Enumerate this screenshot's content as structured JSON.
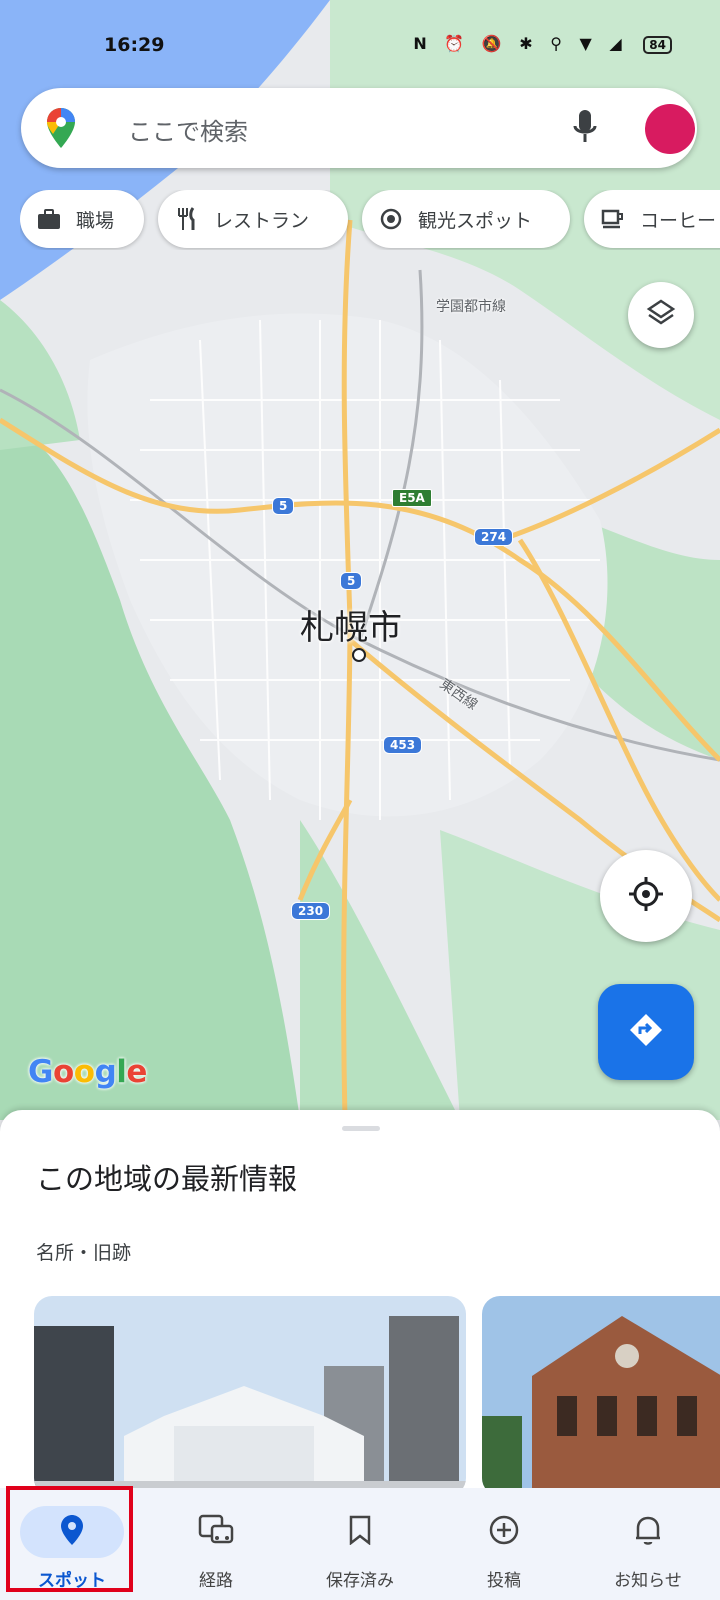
{
  "status_bar": {
    "time": "16:29",
    "icons": "N ⏰ 🔕 ✱ ⚲ ▼ ◢",
    "battery": "84"
  },
  "search": {
    "placeholder": "ここで検索"
  },
  "chips": [
    {
      "label": "職場",
      "icon": "briefcase-icon"
    },
    {
      "label": "レストラン",
      "icon": "fork-knife-icon"
    },
    {
      "label": "観光スポット",
      "icon": "camera-icon"
    },
    {
      "label": "コーヒー",
      "icon": "coffee-icon"
    }
  ],
  "map": {
    "city_label": "札幌市",
    "labels": [
      "学園都市線",
      "東西線"
    ],
    "shields": [
      "5",
      "5",
      "E5A",
      "274",
      "453",
      "230"
    ],
    "attribution": "Google"
  },
  "sheet": {
    "title": "この地域の最新情報",
    "subtitle": "名所・旧跡"
  },
  "nav": [
    {
      "label": "スポット",
      "icon": "location-pin-icon",
      "active": true
    },
    {
      "label": "経路",
      "icon": "commute-icon",
      "active": false
    },
    {
      "label": "保存済み",
      "icon": "bookmark-icon",
      "active": false
    },
    {
      "label": "投稿",
      "icon": "add-circle-icon",
      "active": false
    },
    {
      "label": "お知らせ",
      "icon": "bell-icon",
      "active": false
    }
  ],
  "colors": {
    "accent": "#1a73e8",
    "nav_active": "#0b57d0",
    "highlight": "#e0001b"
  }
}
